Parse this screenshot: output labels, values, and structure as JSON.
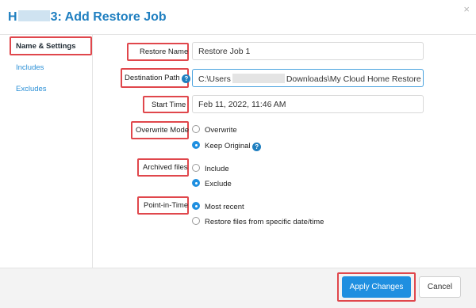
{
  "dialog": {
    "title_prefix": "H",
    "title_suffix": "3: Add Restore Job",
    "close_glyph": "×"
  },
  "sidebar": {
    "items": [
      {
        "label": "Name & Settings",
        "active": true
      },
      {
        "label": "Includes",
        "active": false
      },
      {
        "label": "Excludes",
        "active": false
      }
    ]
  },
  "form": {
    "restore_name": {
      "label": "Restore Name",
      "value": "Restore Job 1"
    },
    "destination_path": {
      "label": "Destination Path",
      "value_prefix": "C:\\Users",
      "value_suffix": "Downloads\\My Cloud Home Restore",
      "help_icon": "help-icon"
    },
    "start_time": {
      "label": "Start Time",
      "value": "Feb 11, 2022, 11:46 AM"
    },
    "overwrite_mode": {
      "label": "Overwrite Mode",
      "options": [
        {
          "label": "Overwrite",
          "checked": false
        },
        {
          "label": "Keep Original",
          "checked": true
        }
      ]
    },
    "archived_files": {
      "label": "Archived files",
      "options": [
        {
          "label": "Include",
          "checked": false
        },
        {
          "label": "Exclude",
          "checked": true
        }
      ]
    },
    "point_in_time": {
      "label": "Point-in-Time",
      "options": [
        {
          "label": "Most recent",
          "checked": true
        },
        {
          "label": "Restore files from specific date/time",
          "checked": false
        }
      ]
    }
  },
  "footer": {
    "apply_label": "Apply Changes",
    "cancel_label": "Cancel"
  },
  "colors": {
    "accent": "#1f8fe0",
    "highlight": "#e0474c",
    "link": "#2a8fd6"
  }
}
